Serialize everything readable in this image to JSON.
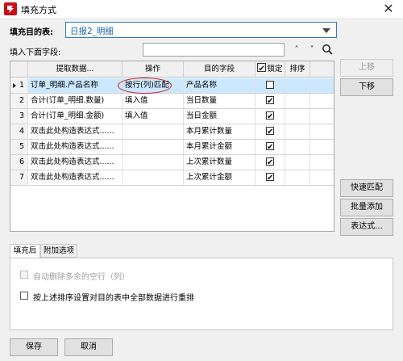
{
  "window": {
    "title": "填充方式",
    "close_glyph": "✕"
  },
  "target_table": {
    "label": "填充目的表:",
    "value": "日报2_明细"
  },
  "field_search": {
    "label": "填入下面字段:",
    "value": "",
    "up_glyph": "˄",
    "down_glyph": "˅",
    "search_glyph": "⚲"
  },
  "grid": {
    "columns": [
      "提取数据...",
      "操作",
      "目的字段",
      "锁定",
      "排序"
    ],
    "rows": [
      {
        "num": "1",
        "source": "订单_明细.产品名称",
        "op": "按行(列)匹配",
        "target": "产品名称",
        "locked": false,
        "sort": "",
        "selected": true
      },
      {
        "num": "2",
        "source": "合计(订单_明细.数量)",
        "op": "填入值",
        "target": "当日数量",
        "locked": true,
        "sort": "",
        "selected": false
      },
      {
        "num": "3",
        "source": "合计(订单_明细.金额)",
        "op": "填入值",
        "target": "当日金额",
        "locked": true,
        "sort": "",
        "selected": false
      },
      {
        "num": "4",
        "source": "双击此处构造表达式......",
        "op": "",
        "target": "本月累计数量",
        "locked": true,
        "sort": "",
        "selected": false
      },
      {
        "num": "5",
        "source": "双击此处构造表达式......",
        "op": "",
        "target": "本月累计金额",
        "locked": true,
        "sort": "",
        "selected": false
      },
      {
        "num": "6",
        "source": "双击此处构造表达式......",
        "op": "",
        "target": "上次累计数量",
        "locked": true,
        "sort": "",
        "selected": false
      },
      {
        "num": "7",
        "source": "双击此处构造表达式......",
        "op": "",
        "target": "上次累计金额",
        "locked": true,
        "sort": "",
        "selected": false
      }
    ]
  },
  "side_buttons": {
    "move_up": "上移",
    "move_down": "下移",
    "quick_match": "快速匹配",
    "batch_add": "批量添加",
    "expression": "表达式..."
  },
  "tabs": [
    "填充后",
    "附加选项"
  ],
  "options": {
    "delete_empty_rows": "自动删除多余的空行（列）",
    "resort": "按上述排序设置对目的表中全部数据进行重排"
  },
  "footer": {
    "save": "保存",
    "cancel": "取消"
  },
  "colors": {
    "selection": "#cce8ff",
    "combo_border": "#2c7ac8",
    "annotation_circle": "#cc1b1b"
  }
}
